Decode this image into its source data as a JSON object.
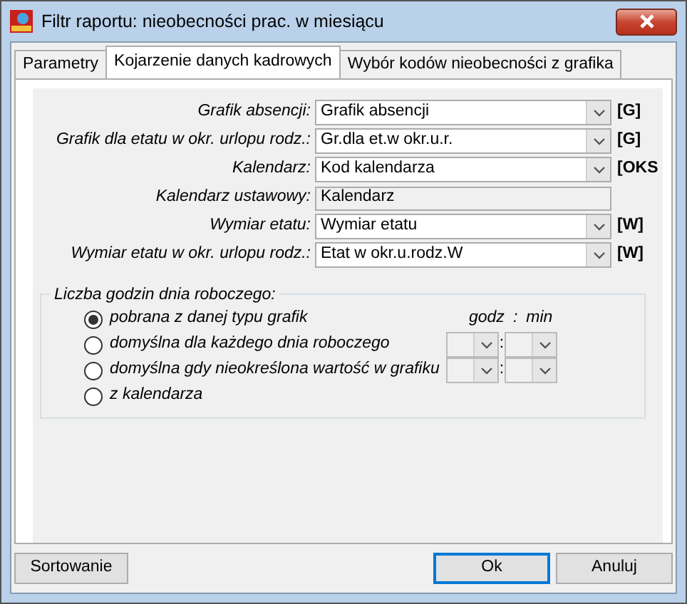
{
  "window": {
    "title": "Filtr raportu: nieobecności prac. w miesiącu"
  },
  "tabs": [
    {
      "label": "Parametry",
      "selected": false
    },
    {
      "label": "Kojarzenie danych kadrowych",
      "selected": true
    },
    {
      "label": "Wybór kodów nieobecności z grafika",
      "selected": false
    }
  ],
  "fields": [
    {
      "label": "Grafik absencji:",
      "value": "Grafik absencji",
      "kind": "dropdown",
      "tag": "[G]"
    },
    {
      "label": "Grafik dla etatu w okr. urlopu rodz.:",
      "value": "Gr.dla et.w okr.u.r.",
      "kind": "dropdown",
      "tag": "[G]"
    },
    {
      "label": "Kalendarz:",
      "value": "Kod kalendarza",
      "kind": "dropdown",
      "tag": "[OKS"
    },
    {
      "label": "Kalendarz ustawowy:",
      "value": "Kalendarz",
      "kind": "text"
    },
    {
      "label": "Wymiar etatu:",
      "value": "Wymiar etatu",
      "kind": "dropdown",
      "tag": "[W]"
    },
    {
      "label": "Wymiar etatu w okr. urlopu rodz.:",
      "value": "Etat w okr.u.rodz.W",
      "kind": "dropdown",
      "tag": "[W]"
    }
  ],
  "hours_group": {
    "title": "Liczba godzin dnia roboczego:",
    "header_hours": "godz",
    "header_separator": ":",
    "header_minutes": "min",
    "options": [
      {
        "label": "pobrana z danej typu grafik",
        "selected": true
      },
      {
        "label": "domyślna dla każdego dnia roboczego",
        "selected": false,
        "time_separator": ":"
      },
      {
        "label": "domyślna gdy nieokreślona wartość w grafiku",
        "selected": false,
        "time_separator": ":"
      },
      {
        "label": "z kalendarza",
        "selected": false
      }
    ]
  },
  "buttons": [
    {
      "label": "Sortowanie",
      "focused": false,
      "kind": "left"
    },
    {
      "label": "Ok",
      "focused": true,
      "kind": "right"
    },
    {
      "label": "Anuluj",
      "focused": false,
      "kind": "right"
    }
  ]
}
